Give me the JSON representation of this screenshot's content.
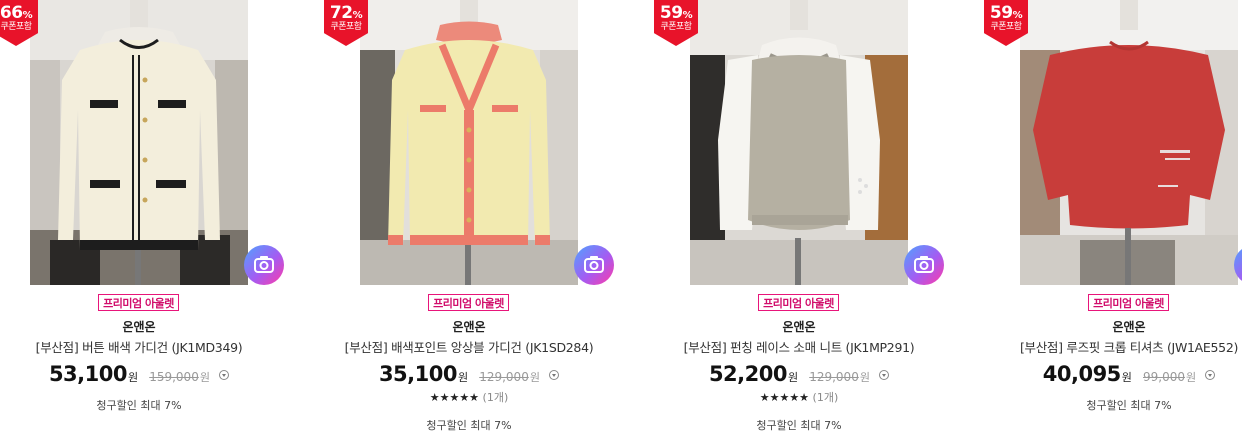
{
  "products": [
    {
      "badge_pct": "66",
      "badge_pct_sign": "%",
      "badge_sub": "쿠폰포함",
      "tag": "프리미엄 아울렛",
      "brand": "온앤온",
      "title": "[부산점] 버튼 배색 가디건 (JK1MD349)",
      "price": "53,100",
      "won": "원",
      "original_price": "159,000",
      "original_won": "원",
      "rating_stars": "",
      "rating_count": "",
      "card_discount": "청구할인 최대 7%",
      "icons": {
        "camera": "camera-search-icon",
        "info": "info-circle-icon"
      }
    },
    {
      "badge_pct": "72",
      "badge_pct_sign": "%",
      "badge_sub": "쿠폰포함",
      "tag": "프리미엄 아울렛",
      "brand": "온앤온",
      "title": "[부산점] 배색포인트 앙상블 가디건 (JK1SD284)",
      "price": "35,100",
      "won": "원",
      "original_price": "129,000",
      "original_won": "원",
      "rating_stars": "★★★★★",
      "rating_count": "(1개)",
      "card_discount": "청구할인 최대 7%"
    },
    {
      "badge_pct": "59",
      "badge_pct_sign": "%",
      "badge_sub": "쿠폰포함",
      "tag": "프리미엄 아울렛",
      "brand": "온앤온",
      "title": "[부산점] 펀칭 레이스 소매 니트 (JK1MP291)",
      "price": "52,200",
      "won": "원",
      "original_price": "129,000",
      "original_won": "원",
      "rating_stars": "★★★★★",
      "rating_count": "(1개)",
      "card_discount": "청구할인 최대 7%"
    },
    {
      "badge_pct": "59",
      "badge_pct_sign": "%",
      "badge_sub": "쿠폰포함",
      "tag": "프리미엄 아울렛",
      "brand": "온앤온",
      "title": "[부산점] 루즈핏 크롭 티셔츠 (JW1AE552)",
      "price": "40,095",
      "won": "원",
      "original_price": "99,000",
      "original_won": "원",
      "rating_stars": "",
      "rating_count": "",
      "card_discount": "청구할인 최대 7%"
    }
  ],
  "colors": {
    "badge": "#e8132a",
    "tag_border": "#e8157a",
    "garment1": "#f3eedc",
    "garment2": "#f2eab0",
    "garment2_trim": "#ec7b6a",
    "garment3": "#b5b0a2",
    "garment4": "#c83d3a"
  }
}
